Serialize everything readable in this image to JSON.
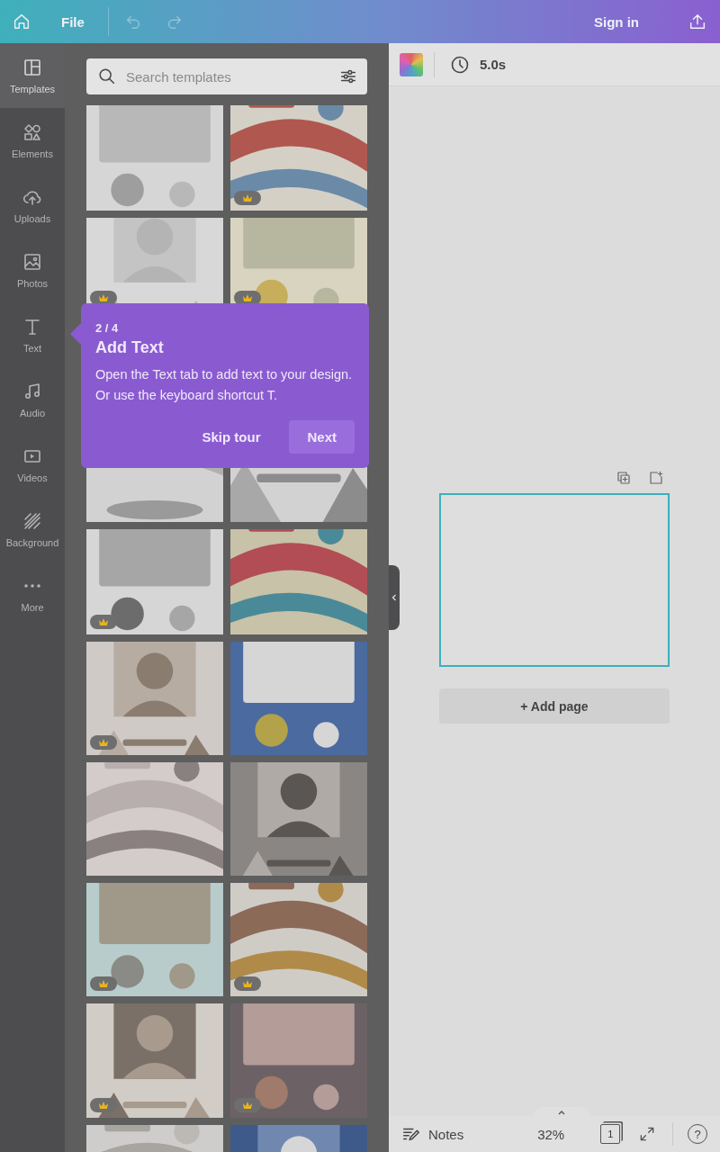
{
  "top_bar": {
    "file_label": "File",
    "sign_in_label": "Sign in"
  },
  "sidebar": {
    "items": [
      {
        "label": "Templates",
        "selected": true
      },
      {
        "label": "Elements",
        "selected": false
      },
      {
        "label": "Uploads",
        "selected": false
      },
      {
        "label": "Photos",
        "selected": false
      },
      {
        "label": "Text",
        "selected": false
      },
      {
        "label": "Audio",
        "selected": false
      },
      {
        "label": "Videos",
        "selected": false
      },
      {
        "label": "Background",
        "selected": false
      },
      {
        "label": "More",
        "selected": false
      }
    ]
  },
  "templates_panel": {
    "search": {
      "placeholder": "Search templates"
    },
    "rows": [
      [
        {
          "kind": "picture",
          "premium": false
        },
        {
          "kind": "picture",
          "premium": true
        }
      ],
      [
        {
          "kind": "picture",
          "premium": true
        },
        {
          "kind": "picture",
          "premium": true
        }
      ],
      [
        {
          "kind": "picture",
          "premium": false
        },
        {
          "kind": "picture",
          "premium": false
        }
      ],
      [
        {
          "kind": "picture",
          "premium": true
        },
        {
          "kind": "picture",
          "premium": false
        }
      ],
      [
        {
          "kind": "picture",
          "premium": true
        },
        {
          "kind": "picture",
          "premium": false
        }
      ],
      [
        {
          "kind": "picture",
          "premium": false
        },
        {
          "kind": "picture",
          "premium": false
        }
      ],
      [
        {
          "kind": "picture",
          "premium": true
        },
        {
          "kind": "picture",
          "premium": true
        }
      ],
      [
        {
          "kind": "picture",
          "premium": true
        },
        {
          "kind": "picture",
          "premium": true
        }
      ],
      [
        {
          "kind": "picture"
        },
        {
          "kind": "picture"
        }
      ]
    ]
  },
  "tour_tip": {
    "step": "2 / 4",
    "title": "Add Text",
    "body": "Open the Text tab to add text to your design. Or use the keyboard shortcut T.",
    "skip_label": "Skip tour",
    "next_label": "Next"
  },
  "toolbar": {
    "duration": "5.0s"
  },
  "canvas": {
    "add_page_label": "+ Add page"
  },
  "footer": {
    "notes_label": "Notes",
    "zoom": "32%",
    "page_count": "1",
    "help_label": "?"
  }
}
